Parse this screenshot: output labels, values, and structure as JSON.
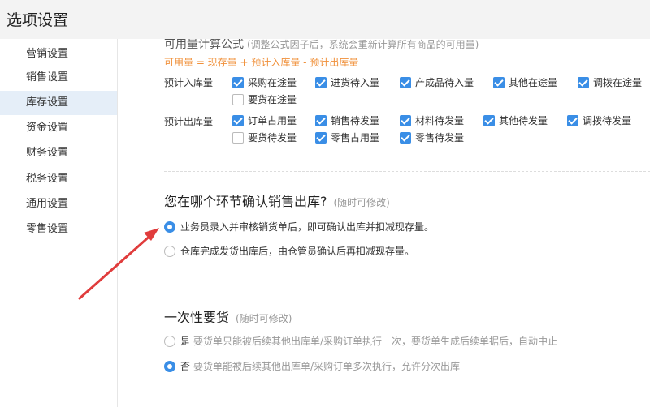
{
  "window": {
    "title": "选项设置"
  },
  "sidebar": {
    "items": [
      {
        "label": "营销设置",
        "active": false
      },
      {
        "label": "销售设置",
        "active": false
      },
      {
        "label": "库存设置",
        "active": true
      },
      {
        "label": "资金设置",
        "active": false
      },
      {
        "label": "财务设置",
        "active": false
      },
      {
        "label": "税务设置",
        "active": false
      },
      {
        "label": "通用设置",
        "active": false
      },
      {
        "label": "零售设置",
        "active": false
      }
    ]
  },
  "availability": {
    "title": "可用量计算公式",
    "note": "(调整公式因子后，系统会重新计算所有商品的可用量)",
    "formula": "可用量 = 现存量 + 预计入库量 - 预计出库量",
    "inbound": {
      "label": "预计入库量",
      "options": [
        {
          "label": "采购在途量",
          "checked": true
        },
        {
          "label": "进货待入量",
          "checked": true
        },
        {
          "label": "产成品待入量",
          "checked": true
        },
        {
          "label": "其他在途量",
          "checked": true
        },
        {
          "label": "调拨在途量",
          "checked": true
        },
        {
          "label": "要货在途量",
          "checked": false
        }
      ]
    },
    "outbound": {
      "label": "预计出库量",
      "options": [
        {
          "label": "订单占用量",
          "checked": true
        },
        {
          "label": "销售待发量",
          "checked": true
        },
        {
          "label": "材料待发量",
          "checked": true
        },
        {
          "label": "其他待发量",
          "checked": true
        },
        {
          "label": "调拨待发量",
          "checked": true
        },
        {
          "label": "要货待发量",
          "checked": false
        },
        {
          "label": "零售占用量",
          "checked": true
        },
        {
          "label": "零售待发量",
          "checked": true
        }
      ]
    }
  },
  "confirm_section": {
    "title": "您在哪个环节确认销售出库?",
    "note": "(随时可修改)",
    "options": [
      {
        "label": "业务员录入并审核销货单后，即可确认出库并扣减现存量。",
        "selected": true
      },
      {
        "label": "仓库完成发货出库后，由仓管员确认后再扣减现存量。",
        "selected": false
      }
    ]
  },
  "once_section": {
    "title": "一次性要货",
    "note": "(随时可修改)",
    "options": [
      {
        "label": "是",
        "desc": "要货单只能被后续其他出库单/采购订单执行一次，要货单生成后续单据后，自动中止",
        "selected": false
      },
      {
        "label": "否",
        "desc": "要货单能被后续其他出库单/采购订单多次执行，允许分次出库",
        "selected": true
      }
    ]
  },
  "colors": {
    "accent": "#3a8ee6",
    "formula": "#f0903a",
    "arrow": "#e03c3c"
  }
}
